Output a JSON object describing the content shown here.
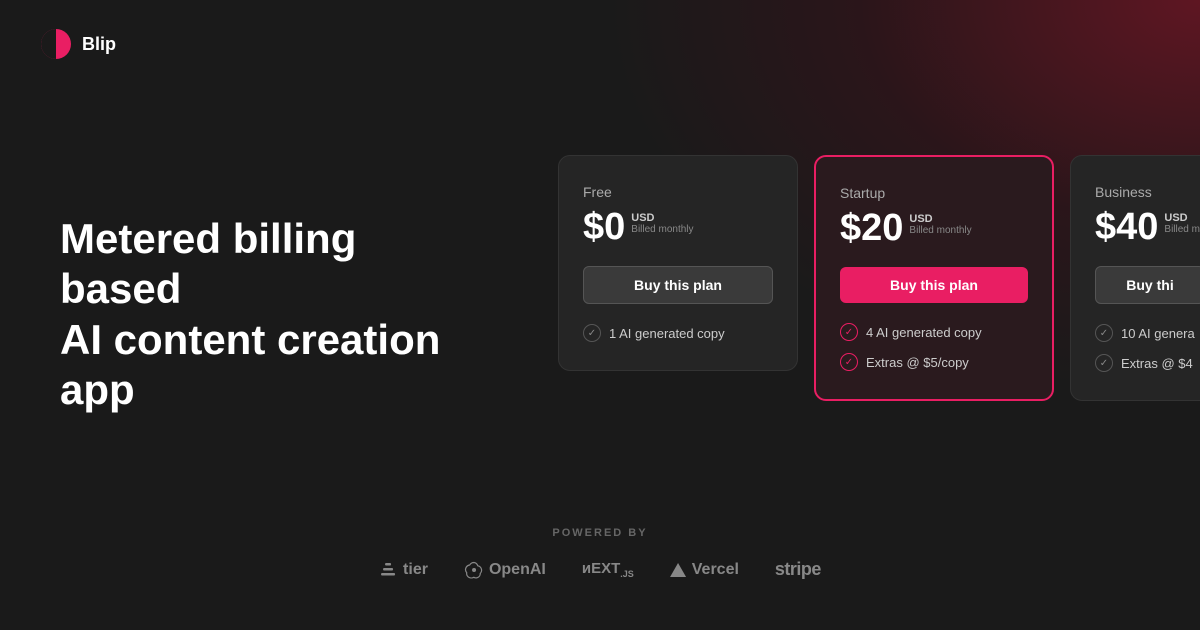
{
  "header": {
    "logo_text": "Blip"
  },
  "hero": {
    "title_line1": "Metered billing based",
    "title_line2": "AI content creation app"
  },
  "pricing": {
    "plans": [
      {
        "id": "free",
        "name": "Free",
        "price": "$0",
        "currency": "USD",
        "billing": "Billed monthly",
        "button_label": "Buy this plan",
        "featured": false,
        "features": [
          "1 AI generated copy"
        ]
      },
      {
        "id": "startup",
        "name": "Startup",
        "price": "$20",
        "currency": "USD",
        "billing": "Billed monthly",
        "button_label": "Buy this plan",
        "featured": true,
        "features": [
          "4 AI generated copy",
          "Extras @ $5/copy"
        ]
      },
      {
        "id": "business",
        "name": "Business",
        "price": "$40",
        "currency": "USD",
        "billing": "Billed monthly",
        "button_label": "Buy thi",
        "featured": false,
        "partial": true,
        "features": [
          "10 AI genera",
          "Extras @ $4"
        ]
      }
    ]
  },
  "powered_by": {
    "label": "POWERED BY",
    "brands": [
      {
        "name": "tier",
        "icon": "tier-icon"
      },
      {
        "name": "OpenAI",
        "icon": "openai-icon"
      },
      {
        "name": "NEXT.js",
        "icon": "nextjs-icon"
      },
      {
        "name": "Vercel",
        "icon": "vercel-icon"
      },
      {
        "name": "stripe",
        "icon": "stripe-icon"
      }
    ]
  }
}
